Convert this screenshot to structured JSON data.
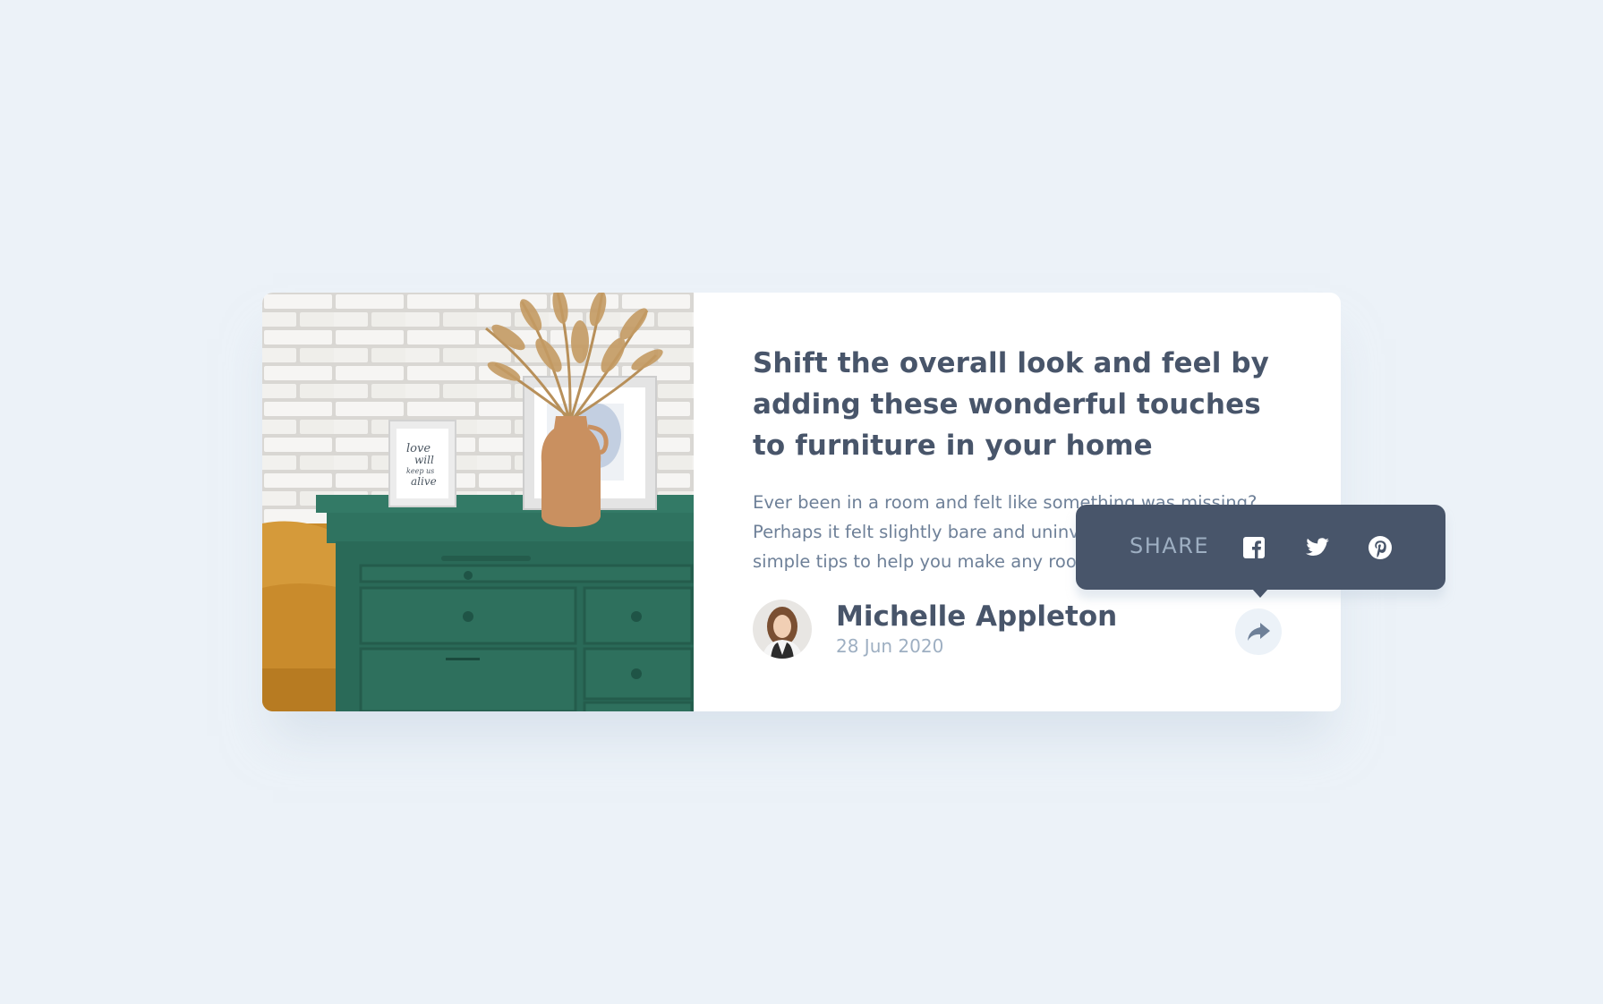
{
  "article": {
    "title": "Shift the overall look and feel by adding these wonderful touches to furniture in your home",
    "excerpt": "Ever been in a room and felt like something was missing? Perhaps it felt slightly bare and uninviting. I’ve got some simple tips to help you make any room feel complete."
  },
  "author": {
    "name": "Michelle Appleton",
    "date": "28 Jun 2020"
  },
  "share": {
    "label": "SHARE",
    "networks": [
      "facebook-icon",
      "twitter-icon",
      "pinterest-icon"
    ]
  },
  "photo": {
    "frame_text": "love will keep us alive"
  },
  "colors": {
    "background": "#ecf2f8",
    "card": "#ffffff",
    "heading": "#48556a",
    "body": "#6e8098",
    "muted": "#9eafc2",
    "tooltip": "#48556a",
    "dresser": "#2e6b59"
  }
}
